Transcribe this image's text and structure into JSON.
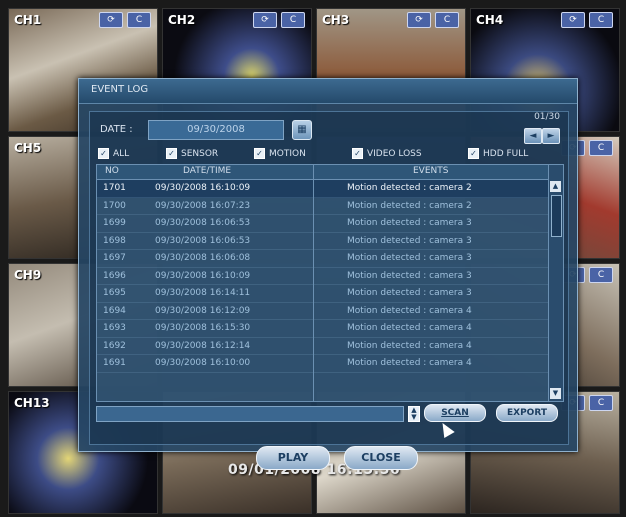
{
  "cameras": [
    {
      "label": "CH1",
      "icons": [
        "rotate-icon",
        "c-icon"
      ]
    },
    {
      "label": "CH2",
      "icons": [
        "rotate-icon",
        "c-icon"
      ]
    },
    {
      "label": "CH3",
      "icons": [
        "rotate-icon",
        "c-icon"
      ]
    },
    {
      "label": "CH4",
      "icons": [
        "rotate-icon",
        "c-icon"
      ]
    },
    {
      "label": "CH5",
      "icons": []
    },
    {
      "label": "",
      "icons": []
    },
    {
      "label": "",
      "icons": []
    },
    {
      "label": "",
      "icons": [
        "rotate-icon",
        "c-icon"
      ]
    },
    {
      "label": "CH9",
      "icons": []
    },
    {
      "label": "",
      "icons": []
    },
    {
      "label": "",
      "icons": []
    },
    {
      "label": "",
      "icons": [
        "rotate-icon",
        "c-icon"
      ]
    },
    {
      "label": "CH13",
      "icons": []
    },
    {
      "label": "",
      "icons": []
    },
    {
      "label": "",
      "icons": []
    },
    {
      "label": "",
      "icons": [
        "rotate-icon",
        "c-icon"
      ]
    }
  ],
  "timestamp": "09/01/2008 16:15:56",
  "dialog": {
    "title": "EVENT LOG",
    "date_label": "DATE :",
    "date_value": "09/30/2008",
    "page": "01/30",
    "filters": {
      "all": "ALL",
      "sensor": "SENSOR",
      "motion": "MOTION",
      "video_loss": "VIDEO LOSS",
      "hdd_full": "HDD FULL"
    },
    "columns": {
      "no": "NO",
      "datetime": "DATE/TIME",
      "events": "EVENTS"
    },
    "rows": [
      {
        "no": "1701",
        "datetime": "09/30/2008  16:10:09",
        "event": "Motion detected : camera 2",
        "selected": true
      },
      {
        "no": "1700",
        "datetime": "09/30/2008  16:07:23",
        "event": "Motion detected : camera 2",
        "selected": false
      },
      {
        "no": "1699",
        "datetime": "09/30/2008  16:06:53",
        "event": "Motion detected : camera 3",
        "selected": false
      },
      {
        "no": "1698",
        "datetime": "09/30/2008  16:06:53",
        "event": "Motion detected : camera 3",
        "selected": false
      },
      {
        "no": "1697",
        "datetime": "09/30/2008  16:06:08",
        "event": "Motion detected : camera 3",
        "selected": false
      },
      {
        "no": "1696",
        "datetime": "09/30/2008  16:10:09",
        "event": "Motion detected : camera 3",
        "selected": false
      },
      {
        "no": "1695",
        "datetime": "09/30/2008  16:14:11",
        "event": "Motion detected : camera 3",
        "selected": false
      },
      {
        "no": "1694",
        "datetime": "09/30/2008  16:12:09",
        "event": "Motion detected : camera 4",
        "selected": false
      },
      {
        "no": "1693",
        "datetime": "09/30/2008  16:15:30",
        "event": "Motion detected : camera 4",
        "selected": false
      },
      {
        "no": "1692",
        "datetime": "09/30/2008  16:12:14",
        "event": "Motion detected : camera 4",
        "selected": false
      },
      {
        "no": "1691",
        "datetime": "09/30/2008  16:10:00",
        "event": "Motion detected : camera 4",
        "selected": false
      }
    ],
    "buttons": {
      "scan": "SCAN",
      "export": "EXPORT",
      "play": "PLAY",
      "close": "CLOSE"
    }
  }
}
